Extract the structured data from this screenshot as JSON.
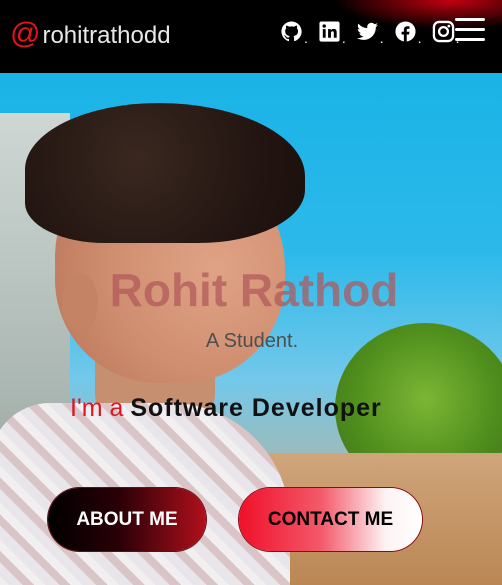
{
  "navbar": {
    "brand_at": "@",
    "brand_name": "rohitrathodd",
    "socials": [
      {
        "icon": "github-icon",
        "label": "."
      },
      {
        "icon": "linkedin-icon",
        "label": "."
      },
      {
        "icon": "twitter-icon",
        "label": "."
      },
      {
        "icon": "facebook-icon",
        "label": "."
      },
      {
        "icon": "instagram-icon",
        "label": "."
      }
    ],
    "menu_icon": "hamburger-menu-icon"
  },
  "hero": {
    "name": "Rohit Rathod",
    "subtitle": "A Student.",
    "tagline_prefix": "I'm a ",
    "tagline_role": "Software Developer"
  },
  "buttons": {
    "about": "ABOUT ME",
    "contact": "CONTACT ME"
  },
  "colors": {
    "accent_red": "#e4141e",
    "navbar_bg": "#000000",
    "sky_blue": "#1ab3e6"
  }
}
